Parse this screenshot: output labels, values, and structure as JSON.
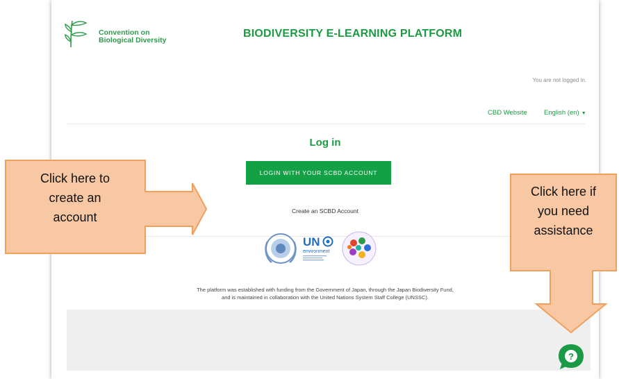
{
  "header": {
    "logo_line1": "Convention on",
    "logo_line2": "Biological Diversity",
    "site_title": "BIODIVERSITY E-LEARNING PLATFORM",
    "login_status": "You are not logged in.",
    "nav": {
      "cbd_website": "CBD Website",
      "language": "English (en)"
    }
  },
  "main": {
    "heading": "Log in",
    "login_button": "LOGIN WITH YOUR SCBD ACCOUNT",
    "create_account_link": "Create an SCBD Account"
  },
  "partners": {
    "un_label": "UN",
    "environment_label": "environment"
  },
  "footer": {
    "line1": "The platform was established with funding from the Government of Japan, through the Japan Biodiversity Fund,",
    "line2": "and is maintained in collaboration with the United Nations System Staff College (UNSSC)."
  },
  "callouts": {
    "create": [
      "Click here to",
      "create an",
      "account"
    ],
    "help": [
      "Click here if",
      "you need",
      "assistance"
    ]
  },
  "colors": {
    "brand_green": "#1b9b41",
    "callout_fill": "#f8c8a4",
    "callout_border": "#f0a05a"
  },
  "icons": {
    "help": "question-chat-icon"
  }
}
